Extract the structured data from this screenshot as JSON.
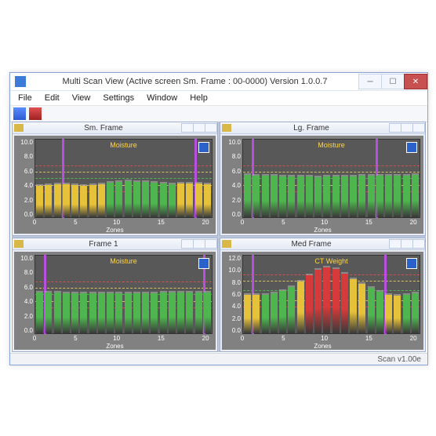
{
  "window": {
    "title": "Multi Scan View (Active screen Sm. Frame : 00-0000) Version 1.0.0.7"
  },
  "menu": [
    "File",
    "Edit",
    "View",
    "Settings",
    "Window",
    "Help"
  ],
  "status": "Scan v1.00e",
  "colors": {
    "green": "#4fb64f",
    "yellow": "#e6c23a",
    "red": "#d63a3a",
    "vline": "#b84fe0",
    "threshold_red": "#d05050",
    "threshold_yellow": "#d8c060",
    "threshold_green": "#4fb64f"
  },
  "panels": [
    {
      "title": "Sm. Frame"
    },
    {
      "title": "Lg. Frame"
    },
    {
      "title": "Frame 1"
    },
    {
      "title": "Med Frame"
    }
  ],
  "chart_data": [
    {
      "type": "bar",
      "title": "Moisture",
      "xlabel": "Zones",
      "ylabel": "",
      "ylim": [
        0,
        10
      ],
      "xlim": [
        0,
        20
      ],
      "yticks": [
        0,
        2,
        4,
        6,
        8,
        10
      ],
      "xticks": [
        0,
        5,
        10,
        15,
        20
      ],
      "vlines": [
        3,
        18
      ],
      "thresholds": [
        {
          "y": 3.2,
          "color": "threshold_red"
        },
        {
          "y": 4.0,
          "color": "threshold_yellow"
        },
        {
          "y": 5.0,
          "color": "threshold_green"
        },
        {
          "y": 5.8,
          "color": "threshold_yellow"
        },
        {
          "y": 6.6,
          "color": "threshold_red"
        }
      ],
      "categories": [
        0,
        1,
        2,
        3,
        4,
        5,
        6,
        7,
        8,
        9,
        10,
        11,
        12,
        13,
        14,
        15,
        16,
        17,
        18,
        19
      ],
      "values": [
        4.0,
        4.1,
        4.2,
        4.2,
        4.1,
        4.0,
        4.1,
        4.2,
        4.4,
        4.5,
        4.6,
        4.5,
        4.5,
        4.4,
        4.3,
        4.2,
        4.3,
        4.3,
        4.3,
        4.2
      ],
      "series_colors": [
        "yellow",
        "yellow",
        "yellow",
        "yellow",
        "yellow",
        "yellow",
        "yellow",
        "yellow",
        "green",
        "green",
        "green",
        "green",
        "green",
        "green",
        "green",
        "green",
        "yellow",
        "yellow",
        "yellow",
        "yellow"
      ]
    },
    {
      "type": "bar",
      "title": "Moisture",
      "xlabel": "Zones",
      "ylabel": "",
      "ylim": [
        0,
        10
      ],
      "xlim": [
        0,
        20
      ],
      "yticks": [
        0,
        2,
        4,
        6,
        8,
        10
      ],
      "xticks": [
        0,
        5,
        10,
        15,
        20
      ],
      "vlines": [
        1,
        15
      ],
      "thresholds": [
        {
          "y": 3.2,
          "color": "threshold_red"
        },
        {
          "y": 4.0,
          "color": "threshold_yellow"
        },
        {
          "y": 5.0,
          "color": "threshold_green"
        },
        {
          "y": 5.8,
          "color": "threshold_yellow"
        },
        {
          "y": 6.6,
          "color": "threshold_red"
        }
      ],
      "categories": [
        0,
        1,
        2,
        3,
        4,
        5,
        6,
        7,
        8,
        9,
        10,
        11,
        12,
        13,
        14,
        15,
        16,
        17,
        18,
        19
      ],
      "values": [
        5.5,
        5.4,
        5.4,
        5.4,
        5.3,
        5.3,
        5.3,
        5.3,
        5.2,
        5.3,
        5.3,
        5.3,
        5.3,
        5.4,
        5.4,
        5.4,
        5.4,
        5.4,
        5.4,
        5.5
      ],
      "series_colors": [
        "green",
        "green",
        "green",
        "green",
        "green",
        "green",
        "green",
        "green",
        "green",
        "green",
        "green",
        "green",
        "green",
        "green",
        "green",
        "green",
        "green",
        "green",
        "green",
        "green"
      ]
    },
    {
      "type": "bar",
      "title": "Moisture",
      "xlabel": "Zones",
      "ylabel": "",
      "ylim": [
        0,
        10
      ],
      "xlim": [
        0,
        20
      ],
      "yticks": [
        0,
        2,
        4,
        6,
        8,
        10
      ],
      "xticks": [
        0,
        5,
        10,
        15,
        20
      ],
      "vlines": [
        1,
        19
      ],
      "thresholds": [
        {
          "y": 3.2,
          "color": "threshold_red"
        },
        {
          "y": 4.0,
          "color": "threshold_yellow"
        },
        {
          "y": 5.0,
          "color": "threshold_green"
        },
        {
          "y": 5.8,
          "color": "threshold_yellow"
        },
        {
          "y": 6.6,
          "color": "threshold_red"
        }
      ],
      "categories": [
        0,
        1,
        2,
        3,
        4,
        5,
        6,
        7,
        8,
        9,
        10,
        11,
        12,
        13,
        14,
        15,
        16,
        17,
        18,
        19
      ],
      "values": [
        5.3,
        5.3,
        5.3,
        5.2,
        5.2,
        5.2,
        5.2,
        5.2,
        5.2,
        5.2,
        5.2,
        5.2,
        5.2,
        5.2,
        5.3,
        5.3,
        5.3,
        5.3,
        5.3,
        5.3
      ],
      "series_colors": [
        "green",
        "green",
        "green",
        "green",
        "green",
        "green",
        "green",
        "green",
        "green",
        "green",
        "green",
        "green",
        "green",
        "green",
        "green",
        "green",
        "green",
        "green",
        "green",
        "green"
      ]
    },
    {
      "type": "bar",
      "title": "CT Weight",
      "xlabel": "Zones",
      "ylabel": "",
      "ylim": [
        0,
        12
      ],
      "xlim": [
        0,
        20
      ],
      "yticks": [
        0,
        2,
        4,
        6,
        8,
        10,
        12
      ],
      "xticks": [
        0,
        5,
        10,
        15,
        20
      ],
      "vlines": [
        1,
        16
      ],
      "thresholds": [
        {
          "y": 4.0,
          "color": "threshold_red"
        },
        {
          "y": 5.0,
          "color": "threshold_yellow"
        },
        {
          "y": 6.5,
          "color": "threshold_green"
        },
        {
          "y": 8.0,
          "color": "threshold_yellow"
        },
        {
          "y": 9.0,
          "color": "threshold_red"
        }
      ],
      "categories": [
        0,
        1,
        2,
        3,
        4,
        5,
        6,
        7,
        8,
        9,
        10,
        11,
        12,
        13,
        14,
        15,
        16,
        17,
        18,
        19
      ],
      "values": [
        6.0,
        5.9,
        6.0,
        6.2,
        6.5,
        7.2,
        8.0,
        9.0,
        9.8,
        10.2,
        10.0,
        9.2,
        8.4,
        7.6,
        7.0,
        6.4,
        6.0,
        5.8,
        6.0,
        6.2
      ],
      "series_colors": [
        "yellow",
        "yellow",
        "green",
        "green",
        "green",
        "green",
        "yellow",
        "red",
        "red",
        "red",
        "red",
        "red",
        "yellow",
        "yellow",
        "green",
        "green",
        "yellow",
        "yellow",
        "green",
        "green"
      ]
    }
  ]
}
